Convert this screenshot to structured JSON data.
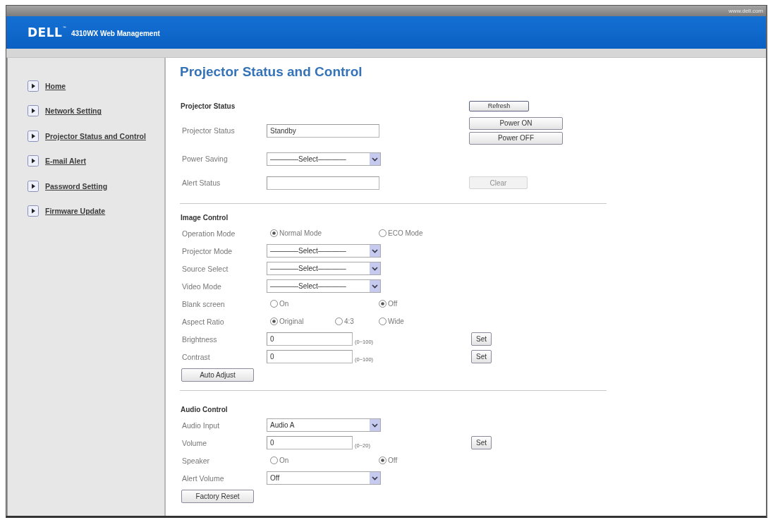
{
  "top_bar": {
    "link": "www.dell.com"
  },
  "header": {
    "logo": "DELL$^{™}$",
    "title": "4310WX Web Management"
  },
  "sidebar": {
    "items": [
      "Home",
      "Network Setting",
      "Projector Status and Control",
      "E-mail Alert",
      "Password Setting",
      "Firmware Update"
    ]
  },
  "page_title": "Projector Status and Control",
  "sections": [
    {
      "title": "Projector Status",
      "buttons": [
        {
          "label": "Refresh",
          "disabled": false
        }
      ],
      "rows": [
        {
          "kind": "text",
          "label": "Projector Status",
          "value": "Standby",
          "buttons": [
            {
              "label": "Power ON",
              "disabled": false
            },
            {
              "label": "Power OFF",
              "disabled": false
            }
          ]
        },
        {
          "kind": "select",
          "label": "Power Saving",
          "value": "————Select————"
        },
        {
          "kind": "text",
          "label": "Alert Status",
          "buttons": [
            {
              "label": "Clear",
              "disabled": true
            }
          ]
        }
      ]
    },
    {
      "title": "Image Control",
      "rows": [
        {
          "kind": "radio",
          "label": "Operation Mode",
          "options": [
            {
              "label": "Normal Mode",
              "selected": true
            },
            {
              "label": "ECO Mode",
              "selected": false
            }
          ]
        },
        {
          "kind": "select",
          "label": "Projector Mode",
          "value": "————Select————"
        },
        {
          "kind": "select",
          "label": "Source Select",
          "value": "————Select————"
        },
        {
          "kind": "select",
          "label": "Video Mode",
          "value": "————Select————"
        },
        {
          "kind": "radio",
          "label": "Blank screen",
          "options": [
            {
              "label": "On",
              "selected": false
            },
            {
              "label": "Off",
              "selected": true
            }
          ]
        },
        {
          "kind": "radio",
          "label": "Aspect Ratio",
          "options": [
            {
              "label": "Original",
              "selected": true
            },
            {
              "label": "4:3",
              "selected": false
            },
            {
              "label": "Wide",
              "selected": false
            }
          ]
        },
        {
          "kind": "number",
          "label": "Brightness",
          "value": "0",
          "range": "(0~100)",
          "buttons": [
            {
              "label": "Set",
              "disabled": false
            }
          ]
        },
        {
          "kind": "number",
          "label": "Contrast",
          "value": "0",
          "range": "(0~100)",
          "buttons": [
            {
              "label": "Set",
              "disabled": false
            }
          ]
        }
      ],
      "footer_button": "Auto Adjust"
    },
    {
      "title": "Audio Control",
      "rows": [
        {
          "kind": "select",
          "label": "Audio Input",
          "value": "Audio A"
        },
        {
          "kind": "number",
          "label": "Volume",
          "value": "0",
          "range": "(0~20)",
          "buttons": [
            {
              "label": "Set",
              "disabled": false
            }
          ]
        },
        {
          "kind": "radio",
          "label": "Speaker",
          "options": [
            {
              "label": "On",
              "selected": false
            },
            {
              "label": "Off",
              "selected": true
            }
          ]
        },
        {
          "kind": "select",
          "label": "Alert Volume",
          "value": "Off"
        }
      ],
      "footer_button": "Factory Reset"
    }
  ]
}
